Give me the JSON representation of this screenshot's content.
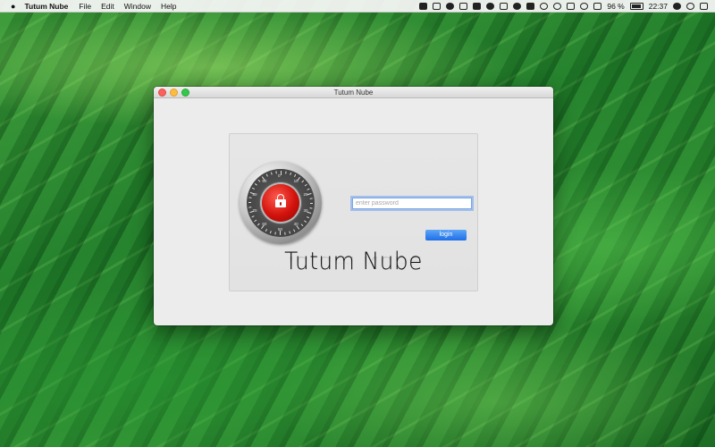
{
  "menubar": {
    "apple_icon": "apple-icon",
    "app_name": "Tutum Nube",
    "menus": [
      "File",
      "Edit",
      "Window",
      "Help"
    ],
    "battery_percent": "96 %",
    "clock": "22:37",
    "status_icons": [
      "camera-icon",
      "drive-icon",
      "evernote-icon",
      "dropbox-icon",
      "screen-icon",
      "chrome-icon",
      "b-icon",
      "settings-icon",
      "keyboard-icon",
      "sync-icon",
      "clock-icon",
      "bluetooth-icon",
      "wifi-icon",
      "volume-icon",
      "battery-icon",
      "user-icon",
      "search-icon",
      "list-icon"
    ]
  },
  "window": {
    "title": "Tutum Nube",
    "login": {
      "password_placeholder": "enter password",
      "password_value": "",
      "login_label": "login",
      "logo_text": "Tutum Nube"
    },
    "dial": {
      "numbers": [
        "0",
        "10",
        "20",
        "30",
        "40",
        "50",
        "60",
        "70",
        "80",
        "90"
      ]
    }
  },
  "colors": {
    "accent": "#1e6ee8",
    "lock_red": "#d2120c",
    "focus_ring": "#7aa7e8"
  }
}
